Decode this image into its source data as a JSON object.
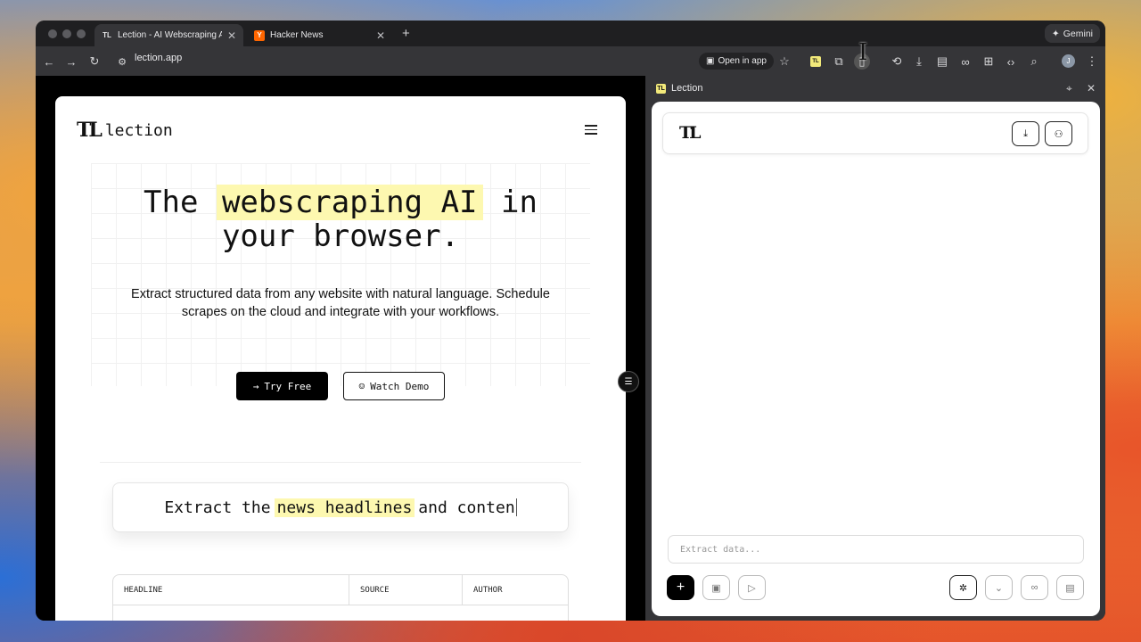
{
  "browser": {
    "tabs": [
      {
        "label": "Lection - AI Webscraping Age",
        "favicon": "TL",
        "active": true
      },
      {
        "label": "Hacker News",
        "favicon": "Y",
        "active": false
      }
    ],
    "gemini_label": "Gemini",
    "url": "lection.app",
    "open_in_app_label": "Open in app",
    "avatar_letter": "J"
  },
  "site": {
    "logo_mark": "TL",
    "logo_text": "lection",
    "hero_pre": "The",
    "hero_highlight": "webscraping AI",
    "hero_post": "in",
    "hero_line2": "your browser.",
    "subtitle": "Extract structured data from any website with natural language. Schedule scrapes on the cloud and integrate with your workflows.",
    "try_free_label": "Try Free",
    "watch_demo_label": "Watch Demo",
    "prompt_pre": "Extract the",
    "prompt_highlight": "news headlines",
    "prompt_post": "and conten",
    "table_headers": [
      "HEADLINE",
      "SOURCE",
      "AUTHOR"
    ]
  },
  "panel": {
    "title": "Lection",
    "logo_mark": "TL",
    "input_placeholder": "Extract data..."
  }
}
